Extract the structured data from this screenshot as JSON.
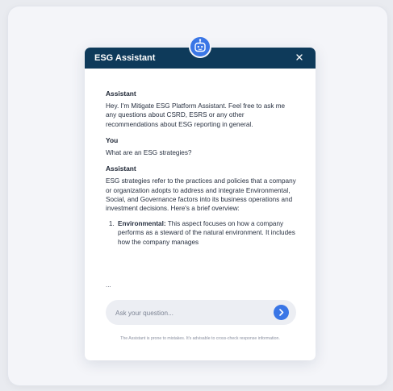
{
  "window": {
    "title": "ESG Assistant",
    "close_icon": "close-icon",
    "avatar_icon": "robot-icon"
  },
  "messages": [
    {
      "sender": "Assistant",
      "text": "Hey. I'm Mitigate ESG Platform Assistant. Feel free to ask me any questions about CSRD, ESRS or any other recommendations about ESG reporting in general."
    },
    {
      "sender": "You",
      "text": "What are an ESG strategies?"
    },
    {
      "sender": "Assistant",
      "text": "ESG strategies refer to the practices and policies that a company or organization adopts to address and integrate Environmental, Social, and Governance factors into its business operations and investment decisions. Here's a brief overview:",
      "list": [
        {
          "term": "Environmental:",
          "text": " This aspect focuses on how a company performs as a steward of the natural environment. It includes how the company manages"
        }
      ]
    }
  ],
  "truncation": "...",
  "input": {
    "placeholder": "Ask your question...",
    "value": "",
    "send_icon": "chevron-right-icon"
  },
  "disclaimer": "The Assistant is prone to mistakes. It's advisable to cross-check response information.",
  "colors": {
    "header_bg": "#0e3a5a",
    "accent": "#3a76e6",
    "page_bg": "#f4f5f9"
  }
}
